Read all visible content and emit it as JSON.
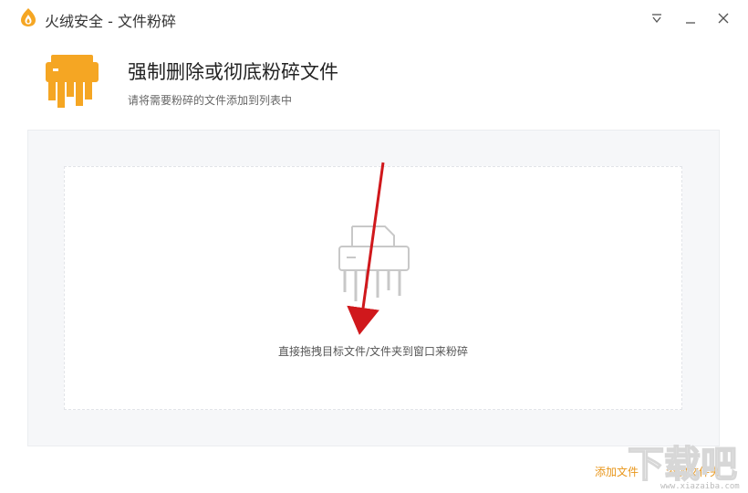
{
  "window": {
    "title": "火绒安全 - 文件粉碎",
    "buttons": [
      "menu-icon",
      "minimize-icon",
      "close-icon"
    ]
  },
  "header": {
    "icon": "shredder-icon",
    "title": "强制删除或彻底粉碎文件",
    "subtitle": "请将需要粉碎的文件添加到列表中"
  },
  "dropzone": {
    "icon": "shredder-outline-icon",
    "hint": "直接拖拽目标文件/文件夹到窗口来粉碎"
  },
  "actions": {
    "add_file": "添加文件",
    "add_folder": "添加文件夹"
  },
  "colors": {
    "accent": "#f5a623",
    "link": "#e8961b",
    "arrow": "#d0181c"
  },
  "watermark": {
    "logo_text": "下载吧",
    "url": "www.xiazaiba.com"
  }
}
